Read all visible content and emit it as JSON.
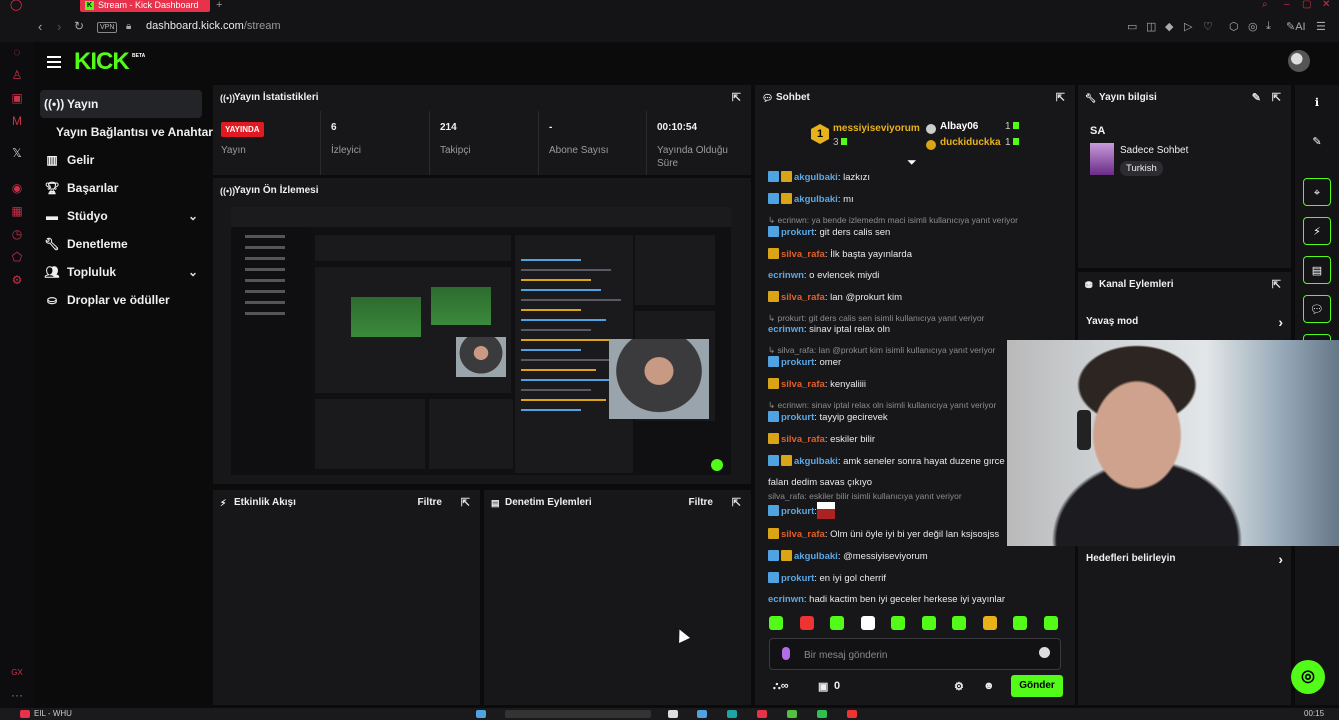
{
  "browser": {
    "tab_title": "Stream - Kick Dashboard",
    "vpn_label": "VPN",
    "url_domain": "dashboard.kick.com",
    "url_path": "/stream",
    "ai_label": "AI"
  },
  "header": {
    "logo": "KICK",
    "beta": "BETA"
  },
  "nav": {
    "items": [
      {
        "label": "Yayın",
        "icon": "broadcast-icon"
      },
      {
        "label": "Yayın Bağlantısı ve Anahtarı",
        "icon": ""
      },
      {
        "label": "Gelir",
        "icon": "revenue-icon"
      },
      {
        "label": "Başarılar",
        "icon": "trophy-icon"
      },
      {
        "label": "Stüdyo",
        "icon": "studio-icon"
      },
      {
        "label": "Denetleme",
        "icon": "wrench-icon"
      },
      {
        "label": "Topluluk",
        "icon": "community-icon"
      },
      {
        "label": "Droplar ve ödüller",
        "icon": "drops-icon"
      }
    ]
  },
  "stats": {
    "title": "Yayın İstatistikleri",
    "items": [
      {
        "value": "YAYINDA",
        "label": "Yayın"
      },
      {
        "value": "6",
        "label": "İzleyici"
      },
      {
        "value": "214",
        "label": "Takipçi"
      },
      {
        "value": "-",
        "label": "Abone Sayısı"
      },
      {
        "value": "00:10:54",
        "label": "Yayında Olduğu Süre"
      }
    ]
  },
  "preview": {
    "title": "Yayın Ön İzlemesi"
  },
  "activity": {
    "title": "Etkinlik Akışı",
    "filter": "Filtre"
  },
  "moderation": {
    "title": "Denetim Eylemleri",
    "filter": "Filtre"
  },
  "chat": {
    "title": "Sohbet",
    "pinned": {
      "rank": "1",
      "top_name": "messiyiseviyorum",
      "top_count": "3",
      "second_name": "Albay06",
      "second_count": "1",
      "third_name": "duckiduckka",
      "third_count": "1"
    },
    "messages": [
      {
        "reply": "",
        "user": "akgulbaki",
        "color": "b",
        "badges": "bg",
        "text": ": lazkızı"
      },
      {
        "reply": "",
        "user": "akgulbaki",
        "color": "b",
        "badges": "bg",
        "text": ": mı"
      },
      {
        "reply": "↳ ecrinwn: ya bende izlemedm maci isimli kullanıcıya yanıt veriyor",
        "user": "prokurt",
        "color": "b",
        "badges": "b",
        "text": ": git ders calis sen"
      },
      {
        "reply": "",
        "user": "silva_rafa",
        "color": "r",
        "badges": "g",
        "text": ": İlk başta yayınlarda"
      },
      {
        "reply": "",
        "user": "ecrinwn",
        "color": "b",
        "badges": "",
        "text": ": o evlencek miydi"
      },
      {
        "reply": "",
        "user": "silva_rafa",
        "color": "r",
        "badges": "g",
        "text": ": lan @prokurt kim"
      },
      {
        "reply": "↳ prokurt: git ders calis sen isimli kullanıcıya yanıt veriyor",
        "user": "ecrinwn",
        "color": "b",
        "badges": "",
        "text": ": sinav iptal relax oln"
      },
      {
        "reply": "↳ silva_rafa: lan @prokurt kim isimli kullanıcıya yanıt veriyor",
        "user": "prokurt",
        "color": "b",
        "badges": "b",
        "text": ": omer"
      },
      {
        "reply": "",
        "user": "silva_rafa",
        "color": "r",
        "badges": "g",
        "text": ": kenyaliiii"
      },
      {
        "reply": "↳ ecrinwn: sinav iptal relax oln isimli kullanıcıya yanıt veriyor",
        "user": "prokurt",
        "color": "b",
        "badges": "b",
        "text": ": tayyip gecirevek"
      },
      {
        "reply": "",
        "user": "silva_rafa",
        "color": "r",
        "badges": "g",
        "text": ": eskiler bilir"
      },
      {
        "reply": "",
        "user": "akgulbaki",
        "color": "b",
        "badges": "bg",
        "text": ": amk seneler sonra hayat duzene gırce"
      },
      {
        "reply": "",
        "user": "",
        "color": "b",
        "badges": "",
        "text": "falan dedim savas çıkıyo"
      },
      {
        "reply": "silva_rafa: eskiler bilir isimli kullanıcıya yanıt veriyor",
        "user": "prokurt",
        "color": "b",
        "badges": "b",
        "text": ":"
      },
      {
        "reply": "",
        "user": "silva_rafa",
        "color": "r",
        "badges": "g",
        "text": ": Olm üni öyle iyi bi yer değil lan ksjsosjss"
      },
      {
        "reply": "",
        "user": "akgulbaki",
        "color": "b",
        "badges": "bg",
        "text": ": @messiyiseviyorum"
      },
      {
        "reply": "",
        "user": "prokurt",
        "color": "b",
        "badges": "b",
        "text": ": en iyi gol cherrif"
      },
      {
        "reply": "",
        "user": "ecrinwn",
        "color": "b",
        "badges": "",
        "text": ": hadi kactim ben iyi geceler herkese iyi yayınlar"
      }
    ],
    "input_placeholder": "Bir mesaj gönderin",
    "footer_count": "0",
    "send_label": "Gönder"
  },
  "info": {
    "title": "Yayın bilgisi",
    "stream_title": "SA",
    "category": "Sadece Sohbet",
    "tag": "Turkish"
  },
  "channel_actions": {
    "title": "Kanal Eylemleri",
    "slow_mode": "Yavaş mod",
    "goals": "Hedefleri belirleyin"
  },
  "taskbar": {
    "media": "EIL - WHU",
    "time": "00:15"
  },
  "colors": {
    "kick_green": "#53fc18",
    "live_red": "#e11a22",
    "opera_red": "#e8324b"
  }
}
